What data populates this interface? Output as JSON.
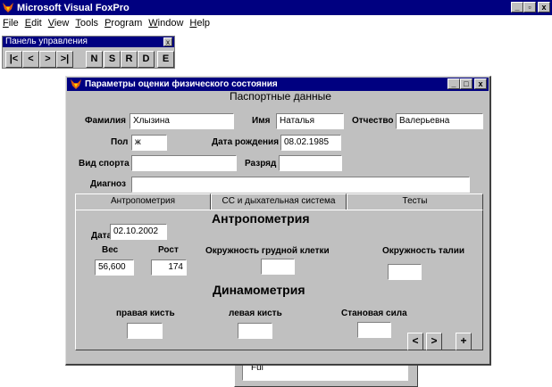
{
  "app": {
    "title": "Microsoft Visual FoxPro",
    "controls": {
      "minimize": "_",
      "maximize": "▫",
      "close": "x"
    }
  },
  "menu": [
    {
      "label": "File",
      "ul": "F",
      "rest": "ile"
    },
    {
      "label": "Edit",
      "ul": "E",
      "rest": "dit"
    },
    {
      "label": "View",
      "ul": "V",
      "rest": "iew"
    },
    {
      "label": "Tools",
      "ul": "T",
      "rest": "ools"
    },
    {
      "label": "Program",
      "ul": "P",
      "rest": "rogram"
    },
    {
      "label": "Window",
      "ul": "W",
      "rest": "indow"
    },
    {
      "label": "Help",
      "ul": "H",
      "rest": "elp"
    }
  ],
  "toolbar": {
    "title": "Панель управления",
    "close": "x",
    "buttons": [
      "|<",
      "<",
      ">",
      ">|",
      "N",
      "S",
      "R",
      "D",
      "E"
    ]
  },
  "background_window": {
    "label": "Ful"
  },
  "dialog": {
    "title": "Параметры оценки  физического состояния",
    "controls": {
      "minimize": "_",
      "maximize": "□",
      "close": "x"
    },
    "passport_heading": "Паспортные данные",
    "fields": {
      "surname": {
        "label": "Фамилия",
        "value": "Хлызина"
      },
      "name": {
        "label": "Имя",
        "value": "Наталья"
      },
      "patronymic": {
        "label": "Отчество",
        "value": "Валерьевна"
      },
      "sex": {
        "label": "Пол",
        "value": "ж"
      },
      "birthdate": {
        "label": "Дата рождения",
        "value": "08.02.1985"
      },
      "sport": {
        "label": "Вид спорта",
        "value": ""
      },
      "rank": {
        "label": "Разряд",
        "value": ""
      },
      "diagnosis": {
        "label": "Диагноз",
        "value": ""
      }
    },
    "tabs": [
      "Антропометрия",
      "СС и дыхательная система",
      "Тесты"
    ],
    "anthropometry": {
      "heading": "Антропометрия",
      "date_label": "Дата",
      "date_value": "02.10.2002",
      "weight_label": "Вес",
      "weight_value": "56,600",
      "height_label": "Рост",
      "height_value": "174",
      "chest_label": "Окружность грудной клетки",
      "chest_value": "",
      "waist_label": "Окружность талии",
      "waist_value": ""
    },
    "dynamometry": {
      "heading": "Динамометрия",
      "right_label": "правая кисть",
      "right_value": "",
      "left_label": "левая кисть",
      "left_value": "",
      "back_label": "Становая сила",
      "back_value": ""
    },
    "nav": {
      "prev": "<",
      "next": ">",
      "add": "+"
    }
  }
}
